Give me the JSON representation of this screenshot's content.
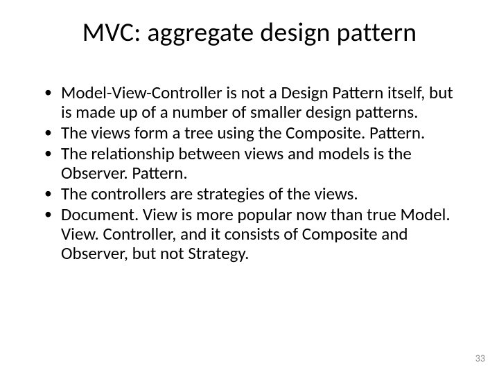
{
  "slide": {
    "title": "MVC: aggregate design pattern",
    "bullets": [
      "Model-View-Controller is not a Design Pattern itself, but is made up of a number of smaller design patterns.",
      "The views form a tree using the Composite. Pattern.",
      "The relationship between views and models is the Observer. Pattern.",
      "The controllers are strategies of the views.",
      "Document. View is more popular now than true Model. View. Controller, and it consists of Composite and Observer, but not Strategy."
    ],
    "page_number": "33"
  }
}
